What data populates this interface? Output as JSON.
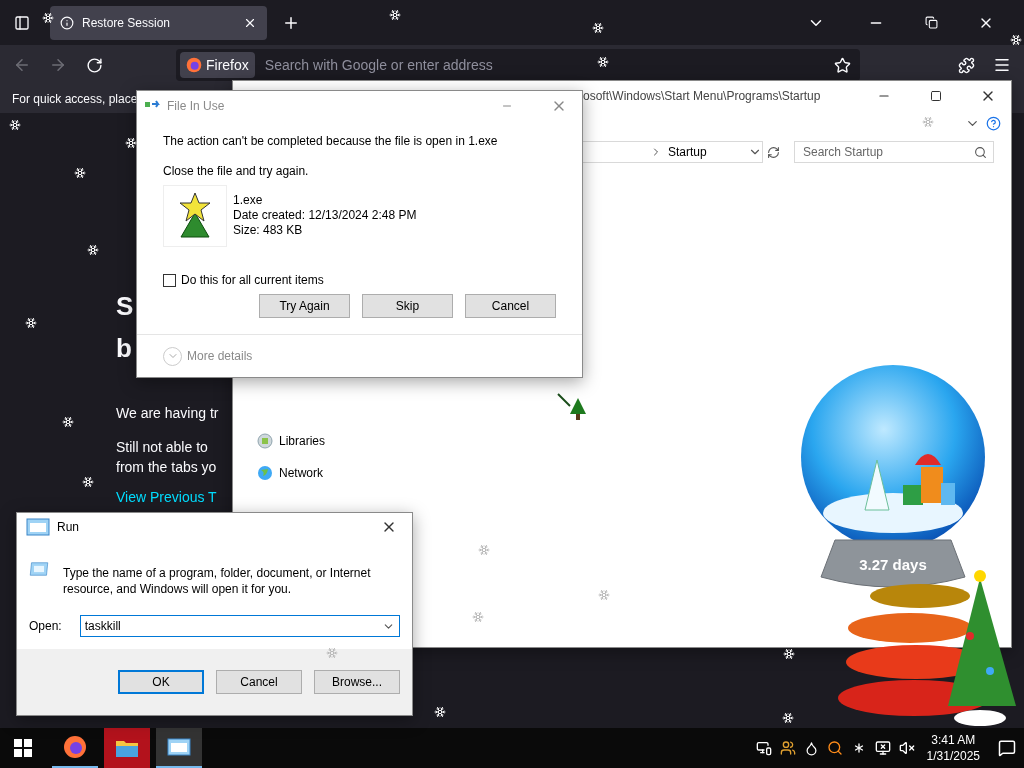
{
  "browser": {
    "tabs": [
      {
        "label": "Restore Session",
        "selected": true
      }
    ],
    "identity": "Firefox",
    "address": {
      "placeholder": "Search with Google or enter address"
    },
    "bookmarks_notice": "For quick access, place",
    "page": {
      "heading_lines": [
        "S",
        "b"
      ],
      "paragraphs": [
        "We are having tr",
        "Still not able to"
      ],
      "paragraph_tail": "from the tabs yo",
      "link": "View Previous T"
    }
  },
  "explorer": {
    "title": "osoft\\Windows\\Start Menu\\Programs\\Startup",
    "breadcrumb": "Startup",
    "search": {
      "placeholder": "Search Startup"
    },
    "nav_items": [
      {
        "label": "Libraries",
        "kind": "libraries"
      },
      {
        "label": "Network",
        "kind": "network"
      }
    ]
  },
  "file_in_use": {
    "title": "File In Use",
    "message": "The action can't be completed because the file is open in 1.exe",
    "instruction": "Close the file and try again.",
    "file": {
      "name": "1.exe",
      "date": "Date created: 12/13/2024 2:48 PM",
      "size": "Size: 483 KB"
    },
    "apply_all": {
      "label": "Do this for all current items",
      "checked": false
    },
    "buttons": [
      "Try Again",
      "Skip",
      "Cancel"
    ],
    "details": "More details"
  },
  "run": {
    "title": "Run",
    "description": "Type the name of a program, folder, document, or Internet resource, and Windows will open it for you.",
    "open_label": "Open:",
    "value": "taskkill",
    "buttons": [
      {
        "label": "OK",
        "selected": true
      },
      {
        "label": "Cancel",
        "selected": false
      },
      {
        "label": "Browse...",
        "selected": false
      }
    ]
  },
  "gadget": {
    "countdown": "3.27 days"
  },
  "taskbar": {
    "apps": [
      {
        "kind": "firefox",
        "selected": false,
        "flashing": false
      },
      {
        "kind": "explorer",
        "selected": false,
        "flashing": true
      },
      {
        "kind": "run",
        "selected": true,
        "flashing": false
      }
    ],
    "time": "3:41 AM",
    "date": "1/31/2025"
  }
}
